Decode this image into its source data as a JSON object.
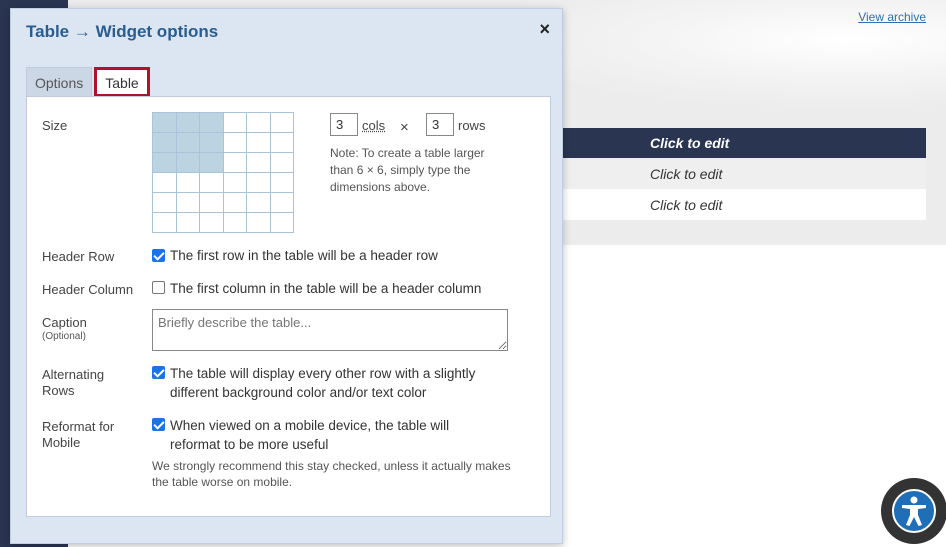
{
  "background": {
    "view_archive": "View archive",
    "table": {
      "header": "Click to edit",
      "rows": [
        "Click to edit",
        "Click to edit"
      ]
    }
  },
  "dialog": {
    "title": "Table → Widget options",
    "close_label": "×",
    "tabs": [
      {
        "label": "Options",
        "active": false
      },
      {
        "label": "Table",
        "active": true
      }
    ],
    "size": {
      "label": "Size",
      "cols_value": "3",
      "cols_label": "cols",
      "times": "×",
      "rows_value": "3",
      "rows_label": "rows",
      "note": "Note: To create a table larger than 6 × 6, simply type the dimensions above."
    },
    "header_row": {
      "label": "Header Row",
      "checked": true,
      "text": "The first row in the table will be a header row"
    },
    "header_column": {
      "label": "Header Column",
      "checked": false,
      "text": "The first column in the table will be a header column"
    },
    "caption": {
      "label": "Caption",
      "sublabel": "(Optional)",
      "value": "",
      "placeholder": "Briefly describe the table..."
    },
    "alternating_rows": {
      "label": "Alternating Rows",
      "checked": true,
      "text": "The table will display every other row with a slightly different background color and/or text color"
    },
    "reformat_mobile": {
      "label": "Reformat for Mobile",
      "checked": true,
      "text": "When viewed on a mobile device, the table will reformat to be more useful",
      "recommendation": "We strongly recommend this stay checked, unless it actually makes the table worse on mobile."
    }
  },
  "colors": {
    "accent": "#2a5d8f",
    "active_tab_border": "#b0122b",
    "grid_selected": "#bcd3e2",
    "dark_navy": "#2a3552"
  },
  "accessibility": {
    "icon": "accessibility-icon"
  }
}
